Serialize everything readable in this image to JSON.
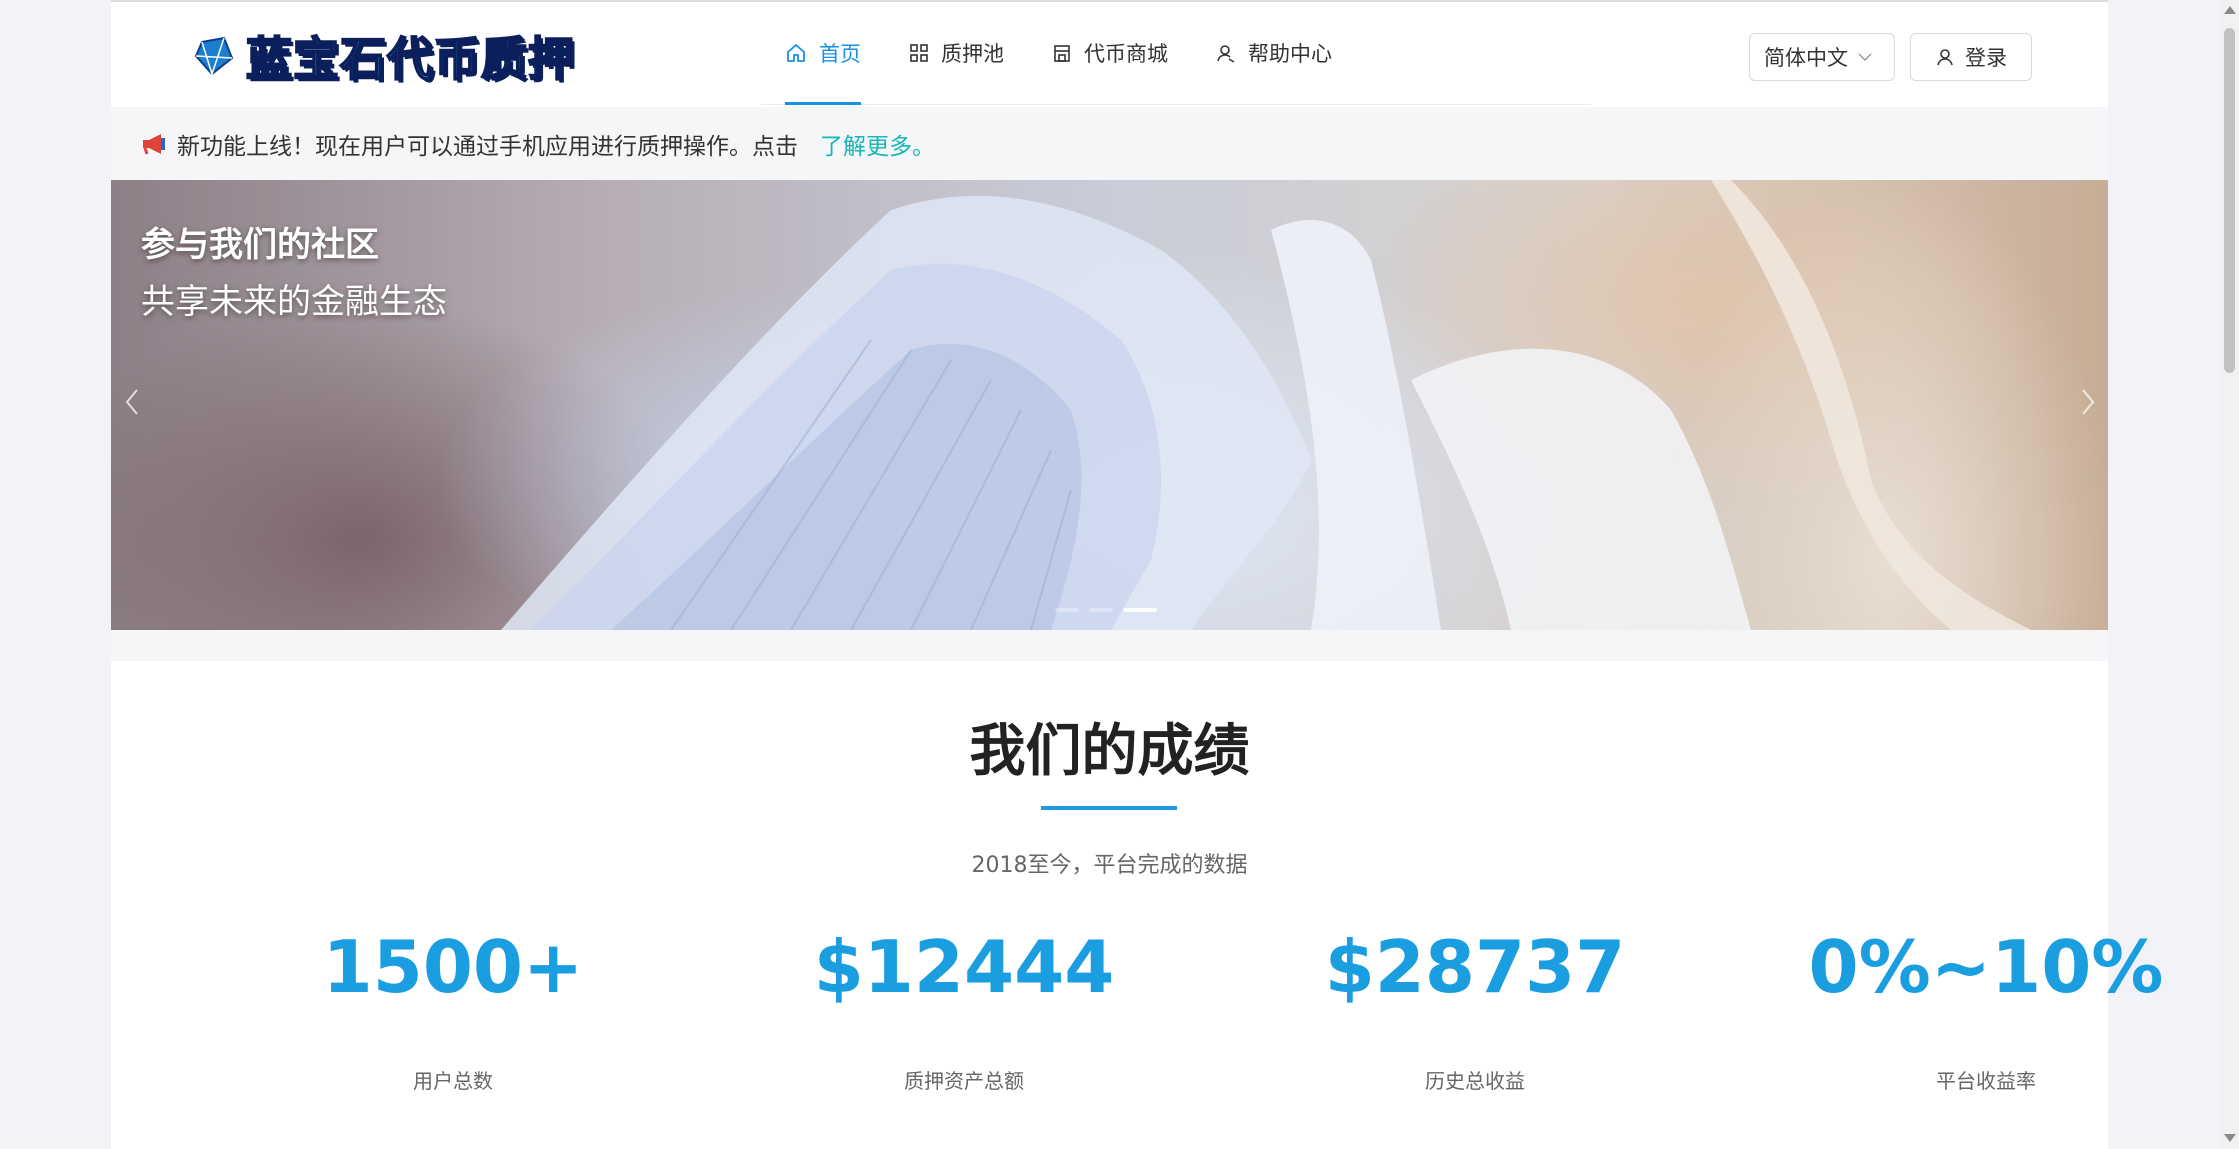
{
  "header": {
    "logo_text": "蓝宝石代币质押",
    "nav": [
      {
        "label": "首页",
        "icon": "home-icon",
        "active": true
      },
      {
        "label": "质押池",
        "icon": "grid-icon",
        "active": false
      },
      {
        "label": "代币商城",
        "icon": "store-icon",
        "active": false
      },
      {
        "label": "帮助中心",
        "icon": "help-user-icon",
        "active": false
      }
    ],
    "language": "简体中文",
    "login_label": "登录"
  },
  "announcement": {
    "text": "新功能上线！现在用户可以通过手机应用进行质押操作。点击",
    "link_text": "了解更多。"
  },
  "banner": {
    "line1": "参与我们的社区",
    "line2": "共享未来的金融生态",
    "active_slide": 3,
    "slide_count": 3
  },
  "stats": {
    "title": "我们的成绩",
    "subtitle": "2018至今，平台完成的数据",
    "items": [
      {
        "value": "1500+",
        "label": "用户总数"
      },
      {
        "value": "$12444",
        "label": "质押资产总额"
      },
      {
        "value": "$28737",
        "label": "历史总收益"
      },
      {
        "value": "0%~10%",
        "label": "平台收益率"
      }
    ]
  },
  "colors": {
    "accent": "#1890e6",
    "stat_blue": "#1a9ee0",
    "link_teal": "#16b6b6"
  }
}
